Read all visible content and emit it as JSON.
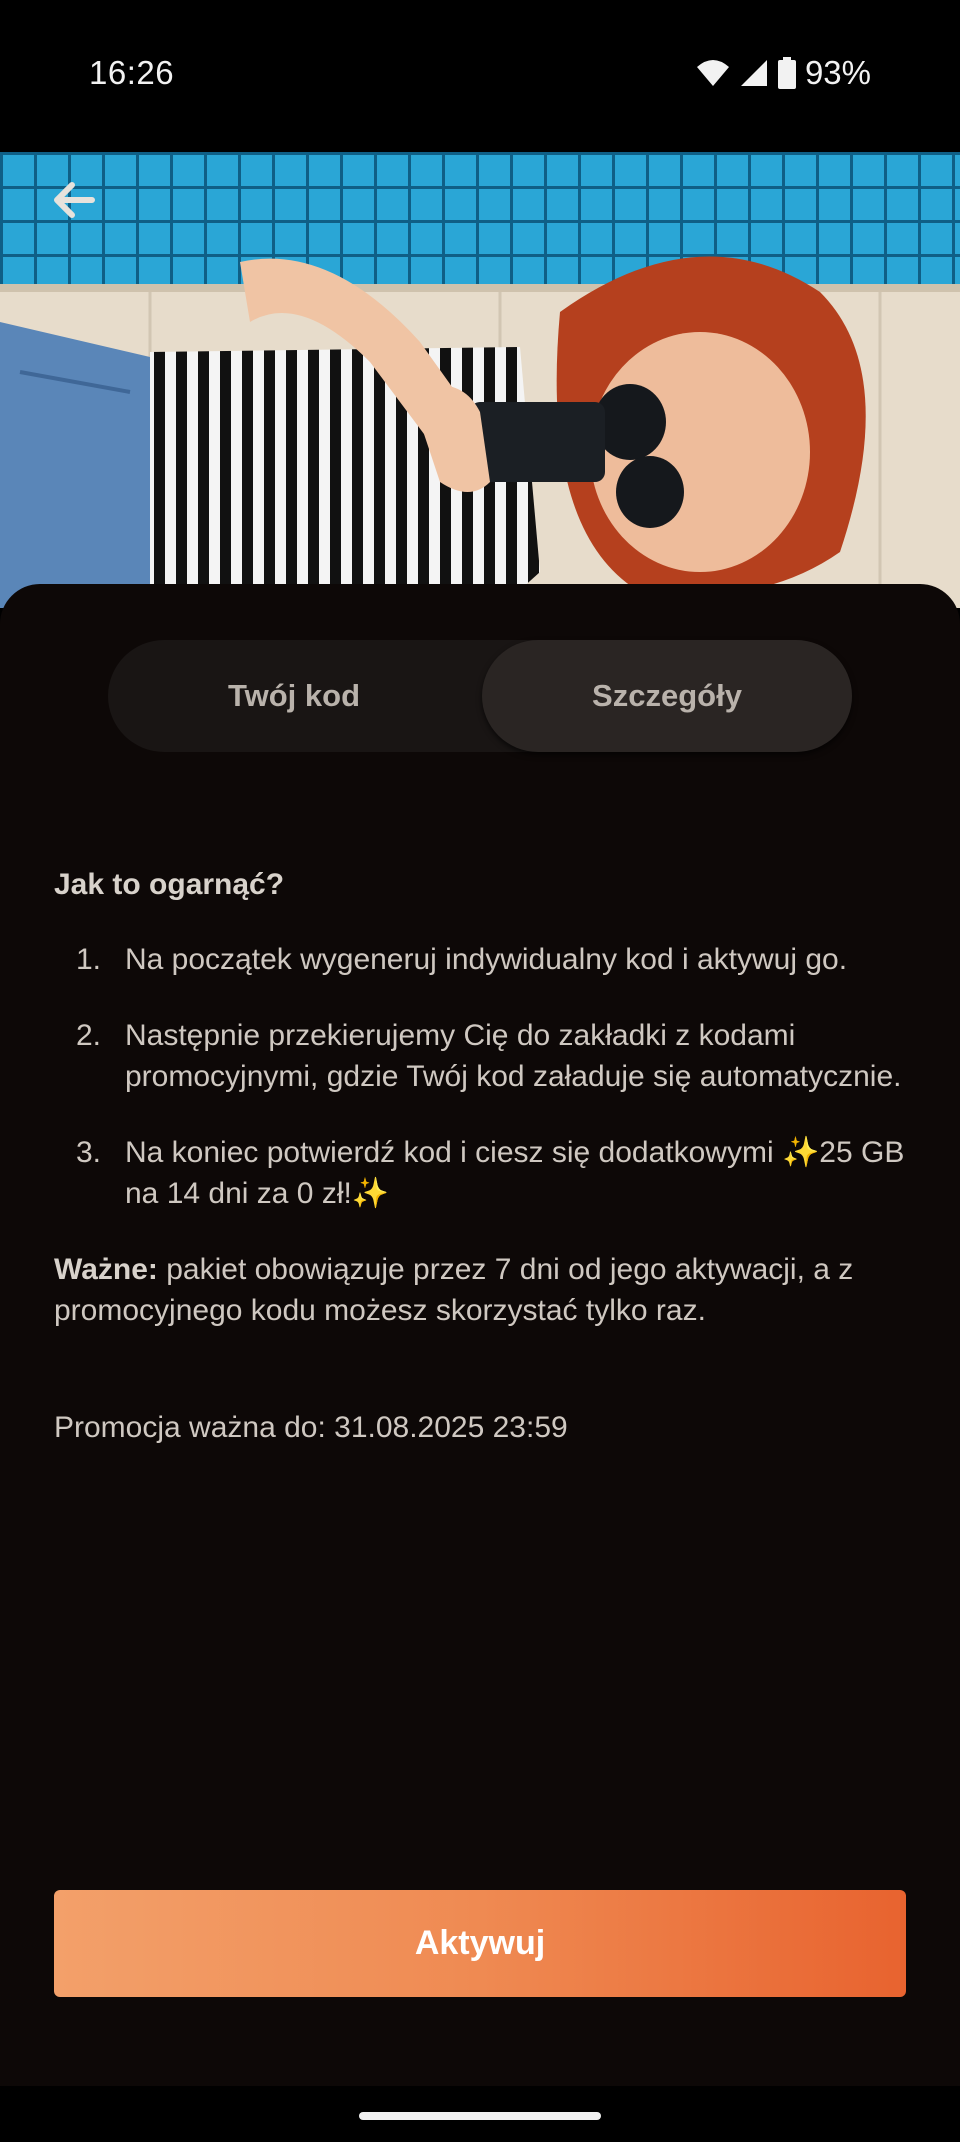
{
  "status_bar": {
    "time": "16:26",
    "battery": "93%",
    "icons": [
      "wifi-icon",
      "cellular-signal-icon",
      "battery-icon"
    ]
  },
  "header": {
    "back_icon": "arrow-left-icon"
  },
  "tabs": [
    {
      "label": "Twój kod",
      "selected": false
    },
    {
      "label": "Szczegóły",
      "selected": true
    }
  ],
  "details": {
    "heading": "Jak to ogarnąć?",
    "steps": [
      {
        "number": "1.",
        "text": "Na początek wygeneruj indywidualny kod i aktywuj go."
      },
      {
        "number": "2.",
        "text": "Następnie przekierujemy Cię do zakładki z kodami promocyjnymi, gdzie Twój kod załaduje się automatycznie."
      },
      {
        "number": "3.",
        "text": "Na koniec potwierdź kod i ciesz się dodatkowymi ✨25 GB na 14 dni za 0 zł!✨"
      }
    ],
    "important_label": "Ważne:",
    "important_text": " pakiet obowiązuje przez 7 dni od jego aktywacji, a z promocyjnego kodu możesz skorzystać tylko raz.",
    "validity": "Promocja ważna do: 31.08.2025 23:59"
  },
  "activate_button": {
    "label": "Aktywuj"
  },
  "colors": {
    "accent_start": "#f3a06a",
    "accent_end": "#e8632f",
    "sheet_bg": "#0d0807"
  }
}
